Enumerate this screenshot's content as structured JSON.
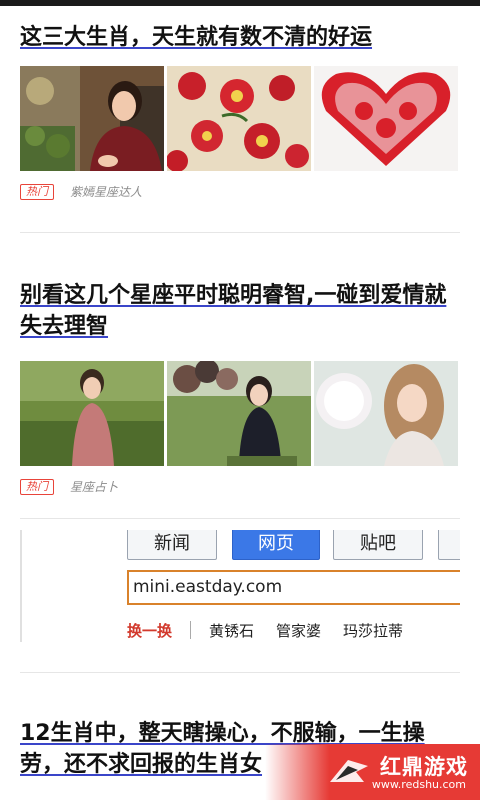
{
  "articles": [
    {
      "title": "这三大生肖，天生就有数不清的好运",
      "badge": "热门",
      "source": "紫嫣星座达人",
      "thumbs": [
        "woman-portrait-photo",
        "red-paper-flowers-photo",
        "red-paper-cut-heart-photo"
      ]
    },
    {
      "title": "别看这几个星座平时聪明睿智,一碰到爱情就失去理智",
      "badge": "热门",
      "source": "星座占卜",
      "thumbs": [
        "girl-in-grass-photo",
        "girl-with-balloons-photo",
        "girl-with-cotton-candy-photo"
      ]
    },
    {
      "title": "12生肖中，整天瞎操心，不服输，一生操劳，还不求回报的生肖女"
    }
  ],
  "search_ad": {
    "tabs": [
      "新闻",
      "网页",
      "贴吧"
    ],
    "active_tab": "网页",
    "address": "mini.eastday.com",
    "refresh_label": "换一换",
    "hot_keywords": [
      "黄锈石",
      "管家婆",
      "玛莎拉蒂"
    ]
  },
  "watermark": {
    "text": "红鼎游戏",
    "url": "www.redshu.com"
  },
  "colors": {
    "accent_underline": "#3a45c9",
    "badge_red": "#e8443a",
    "watermark_red": "#e63a35",
    "search_active_tab": "#3b78e7"
  }
}
